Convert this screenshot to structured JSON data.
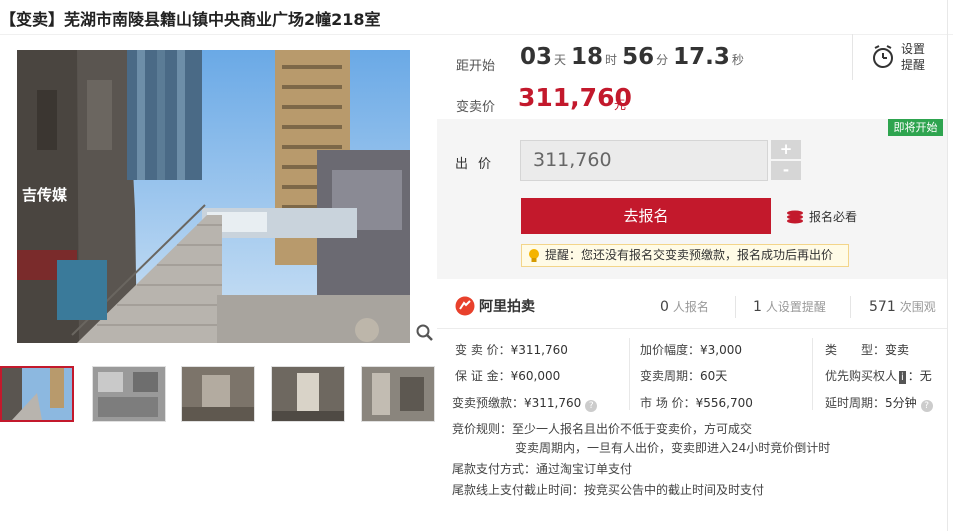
{
  "title": "【变卖】芜湖市南陵县籍山镇中央商业广场2幢218室",
  "countdown": {
    "label": "距开始",
    "days": "03",
    "days_unit": "天",
    "hours": "18",
    "hours_unit": "时",
    "minutes": "56",
    "minutes_unit": "分",
    "seconds": "17.3",
    "seconds_unit": "秒"
  },
  "reminder": {
    "label": "设置提醒",
    "icon": "alarm-clock-icon"
  },
  "price": {
    "label": "变卖价",
    "value": "311,760",
    "unit": "元"
  },
  "status_badge": "即将开始",
  "bid": {
    "label": "出价",
    "value": "311,760",
    "plus": "+",
    "minus": "-",
    "signup_button": "去报名",
    "must_read": "报名必看",
    "tip": "提醒：您还没有报名交变卖预缴款，报名成功后再出价"
  },
  "platform": {
    "logo": "阿里拍卖",
    "signups_count": "0",
    "signups_label": "人报名",
    "reminders_count": "1",
    "reminders_label": "人设置提醒",
    "views_count": "571",
    "views_label": "次围观"
  },
  "details": {
    "sale_price_label": "变 卖 价：",
    "sale_price": "¥311,760",
    "deposit_label": "保 证 金：",
    "deposit": "¥60,000",
    "prepay_label": "变卖预缴款：",
    "prepay": "¥311,760",
    "increment_label": "加价幅度：",
    "increment": "¥3,000",
    "period_label": "变卖周期：",
    "period": "60天",
    "market_label": "市 场 价：",
    "market": "¥556,700",
    "type_label": "类　　型：",
    "type": "变卖",
    "priority_label": "优先购买权人",
    "priority_badge": "i",
    "priority_value": "：无",
    "delay_label": "延时周期：",
    "delay": "5分钟"
  },
  "rules": {
    "bid_rule_label": "竞价规则：",
    "bid_rule_1": "至少一人报名且出价不低于变卖价，方可成交",
    "bid_rule_2": "变卖周期内，一旦有人出价，变卖即进入24小时竞价倒计时",
    "payment_label": "尾款支付方式：",
    "payment": "通过淘宝订单支付",
    "deadline_label": "尾款线上支付截止时间：",
    "deadline": "按竞买公告中的截止时间及时支付"
  },
  "colors": {
    "accent": "#c3192c",
    "badge_green": "#2ea44f"
  },
  "photo": {
    "sign_text": "吉传媒"
  }
}
